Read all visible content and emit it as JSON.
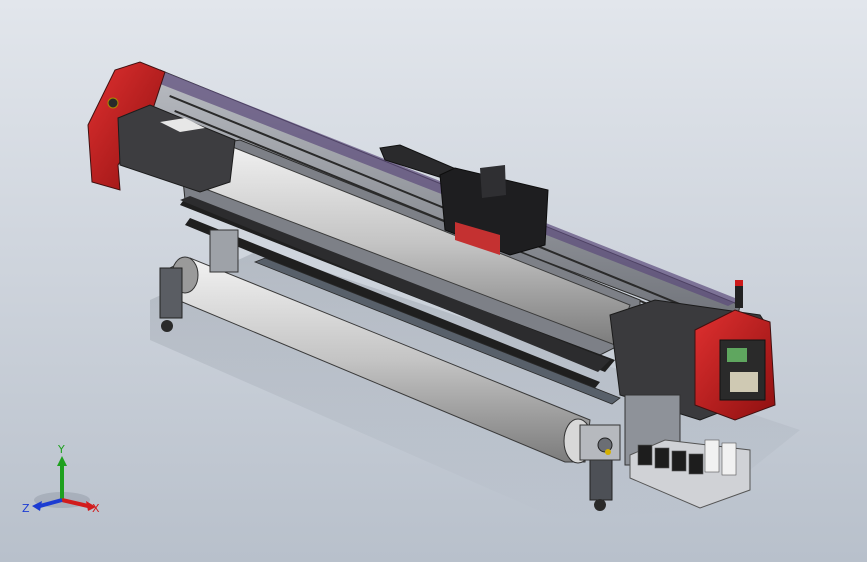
{
  "viewport": {
    "background_top": "#e2e6ec",
    "background_bottom": "#b8c0cb"
  },
  "model": {
    "part": "wide-format-printer-assembly",
    "accent_color": "#cc1f1f",
    "body_color": "#3a3a3c",
    "roller_color": "#c9c9c9"
  },
  "triad": {
    "x_label": "X",
    "y_label": "Y",
    "z_label": "Z",
    "x_color": "#d21c1c",
    "y_color": "#1ea01e",
    "z_color": "#1c3cd2"
  }
}
